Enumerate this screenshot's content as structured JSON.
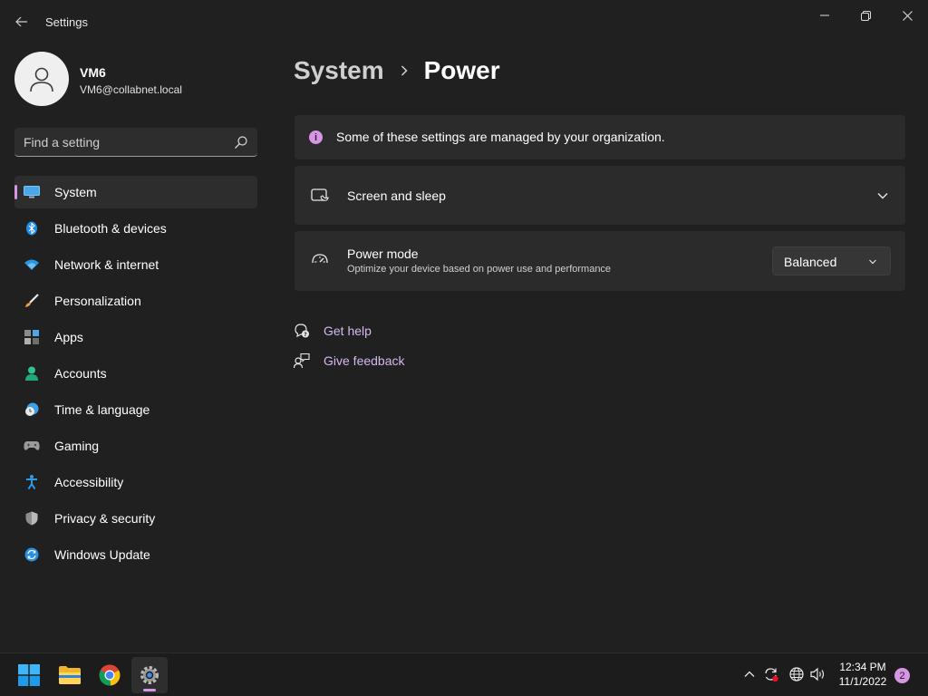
{
  "window": {
    "title": "Settings",
    "controls": [
      "minimize",
      "maximize",
      "close"
    ]
  },
  "user": {
    "name": "VM6",
    "email": "VM6@collabnet.local",
    "avatar_icon": "person-icon"
  },
  "search": {
    "placeholder": "Find a setting",
    "value": ""
  },
  "sidebar": {
    "items": [
      {
        "label": "System",
        "icon": "monitor-icon",
        "active": true
      },
      {
        "label": "Bluetooth & devices",
        "icon": "bluetooth-icon"
      },
      {
        "label": "Network & internet",
        "icon": "wifi-icon"
      },
      {
        "label": "Personalization",
        "icon": "brush-icon"
      },
      {
        "label": "Apps",
        "icon": "apps-icon"
      },
      {
        "label": "Accounts",
        "icon": "account-icon"
      },
      {
        "label": "Time & language",
        "icon": "clock-globe-icon"
      },
      {
        "label": "Gaming",
        "icon": "gamepad-icon"
      },
      {
        "label": "Accessibility",
        "icon": "accessibility-icon"
      },
      {
        "label": "Privacy & security",
        "icon": "shield-icon"
      },
      {
        "label": "Windows Update",
        "icon": "sync-icon"
      }
    ]
  },
  "breadcrumb": {
    "parent": "System",
    "current": "Power"
  },
  "notice": {
    "text": "Some of these settings are managed by your organization."
  },
  "screen_sleep": {
    "title": "Screen and sleep"
  },
  "power_mode": {
    "title": "Power mode",
    "description": "Optimize your device based on power use and performance",
    "selected": "Balanced"
  },
  "links": {
    "help": "Get help",
    "feedback": "Give feedback"
  },
  "taskbar": {
    "time": "12:34 PM",
    "date": "11/1/2022",
    "notification_count": "2"
  },
  "colors": {
    "background": "#202020",
    "card": "#2b2b2b",
    "accent": "#d795e6",
    "link": "#d4b8f0"
  }
}
